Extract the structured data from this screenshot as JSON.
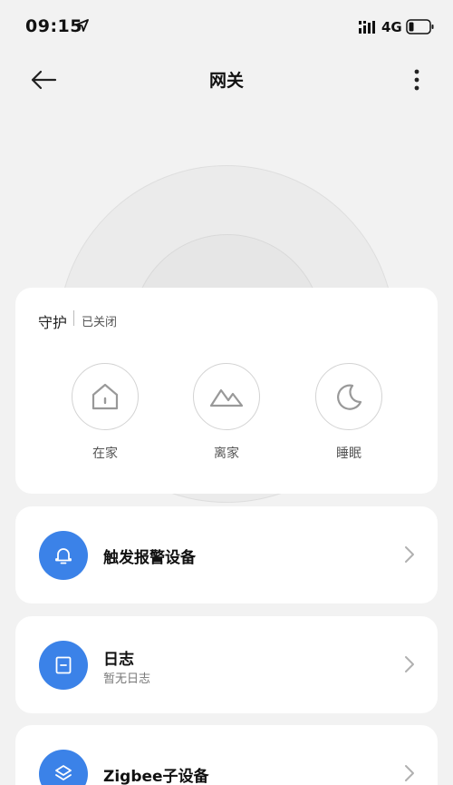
{
  "status_bar": {
    "time": "09:15",
    "network": "4G"
  },
  "header": {
    "title": "网关"
  },
  "guard": {
    "title": "守护",
    "status": "已关闭",
    "modes": [
      {
        "label": "在家",
        "icon": "home-icon"
      },
      {
        "label": "离家",
        "icon": "mountain-icon"
      },
      {
        "label": "睡眠",
        "icon": "moon-icon"
      }
    ]
  },
  "items": [
    {
      "title": "触发报警设备",
      "icon": "bell-icon"
    },
    {
      "title": "日志",
      "subtitle": "暂无日志",
      "icon": "log-icon"
    },
    {
      "title": "Zigbee子设备",
      "icon": "layers-icon"
    }
  ],
  "colors": {
    "accent": "#3b82e8",
    "background": "#f2f2f2",
    "card": "#ffffff"
  }
}
